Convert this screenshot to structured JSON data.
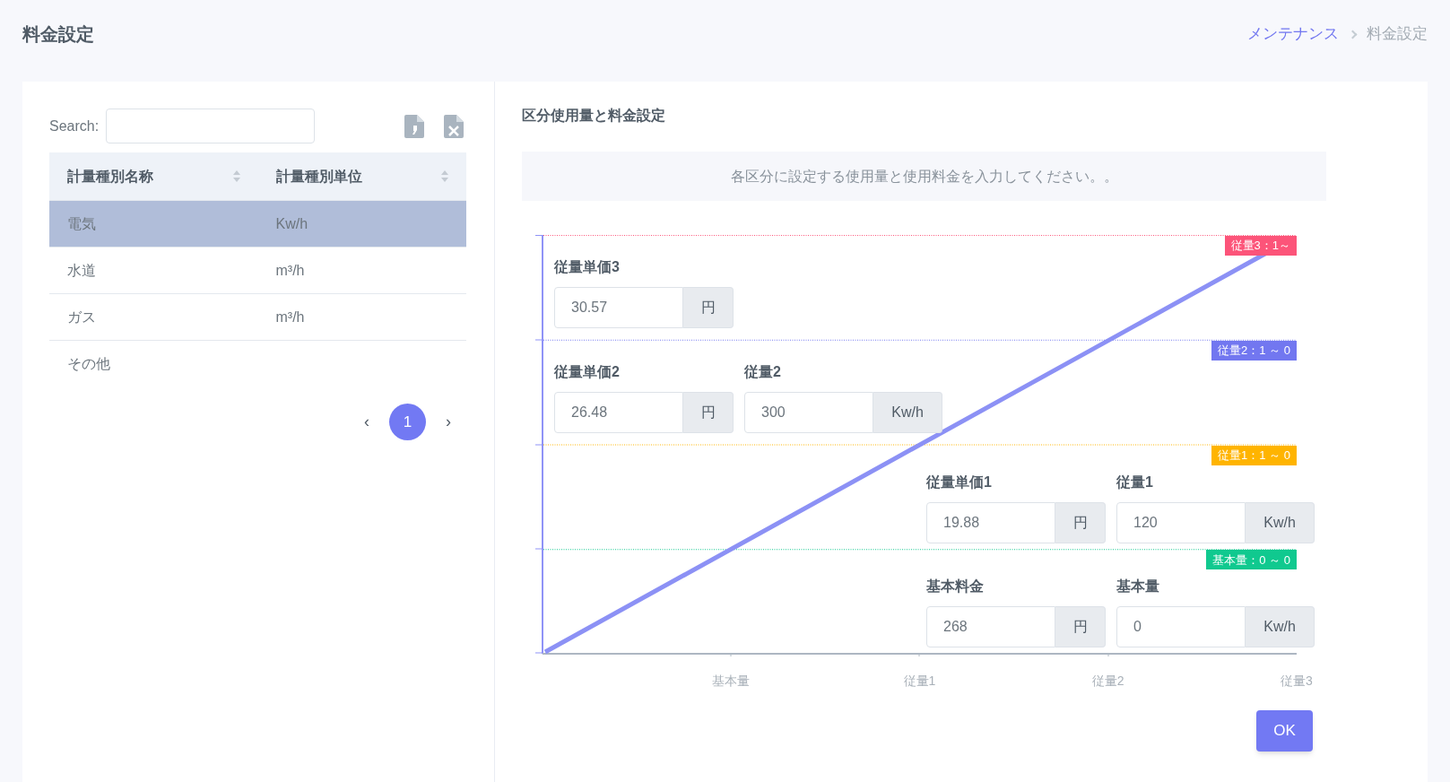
{
  "page_title": "料金設定",
  "breadcrumb": [
    {
      "label": "メンテナンス",
      "link": true
    },
    {
      "label": "料金設定",
      "link": false
    }
  ],
  "search": {
    "label": "Search:"
  },
  "table": {
    "columns": [
      "計量種別名称",
      "計量種別単位"
    ],
    "rows": [
      {
        "cells": [
          "電気",
          "Kw/h"
        ],
        "selected": true
      },
      {
        "cells": [
          "水道",
          "m³/h"
        ],
        "selected": false
      },
      {
        "cells": [
          "ガス",
          "m³/h"
        ],
        "selected": false
      },
      {
        "cells": [
          "その他",
          ""
        ],
        "selected": false
      }
    ]
  },
  "pagination": {
    "prev": "‹",
    "next": "›",
    "pages": [
      {
        "label": "1",
        "selected": true
      }
    ]
  },
  "panel": {
    "title": "区分使用量と料金設定",
    "notice": "各区分に設定する使用量と使用料金を入力してください。。",
    "bands": [
      {
        "badge": "従量3：1～",
        "color": "#fc5479",
        "kind": "left",
        "fields": [
          {
            "label": "従量単価3",
            "value": "30.57",
            "unit": "円"
          }
        ]
      },
      {
        "badge": "従量2：1 ～ 0",
        "color": "#7277f0",
        "kind": "left",
        "fields": [
          {
            "label": "従量単価2",
            "value": "26.48",
            "unit": "円"
          },
          {
            "label": "従量2",
            "value": "300",
            "unit": "Kw/h"
          }
        ]
      },
      {
        "badge": "従量1：1 ～ 0",
        "color": "#ffb400",
        "kind": "right",
        "fields": [
          {
            "label": "従量単価1",
            "value": "19.88",
            "unit": "円"
          },
          {
            "label": "従量1",
            "value": "120",
            "unit": "Kw/h"
          }
        ]
      },
      {
        "badge": "基本量：0 ～ 0",
        "color": "#10c98f",
        "kind": "right",
        "fields": [
          {
            "label": "基本料金",
            "value": "268",
            "unit": "円"
          },
          {
            "label": "基本量",
            "value": "0",
            "unit": "Kw/h"
          }
        ]
      }
    ],
    "axis_labels": [
      "基本量",
      "従量1",
      "従量2",
      "従量3"
    ],
    "ok": "OK"
  }
}
